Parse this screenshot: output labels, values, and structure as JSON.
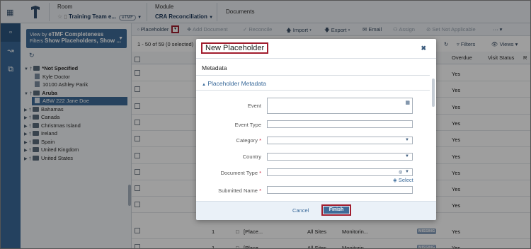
{
  "topbar": {
    "room_label": "Room",
    "room_value": "Training Team e...",
    "room_badge": "eTMF",
    "module_label": "Module",
    "module_value": "CRA Reconciliation",
    "documents_label": "Documents"
  },
  "tree": {
    "viewby_prefix": "View by",
    "viewby_value": "eTMF Completeness",
    "filters_prefix": "Filters",
    "filters_value": "Show Placeholders, Show ...",
    "nodes": [
      {
        "label": "*Not Specified",
        "type": "folder",
        "level": 0,
        "expanded": true
      },
      {
        "label": "Kyle Doctor",
        "type": "doc",
        "level": 1
      },
      {
        "label": "10100 Ashley Parik",
        "type": "doc",
        "level": 1
      },
      {
        "label": "Aruba",
        "type": "folder",
        "level": 0,
        "expanded": true
      },
      {
        "label": "ABW 222 Jane Doe",
        "type": "doc",
        "level": 1,
        "selected": true
      },
      {
        "label": "Bahamas",
        "type": "folder",
        "level": 0
      },
      {
        "label": "Canada",
        "type": "folder",
        "level": 0
      },
      {
        "label": "Christmas Island",
        "type": "folder",
        "level": 0
      },
      {
        "label": "Ireland",
        "type": "folder",
        "level": 0
      },
      {
        "label": "Spain",
        "type": "folder",
        "level": 0
      },
      {
        "label": "United Kingdom",
        "type": "folder",
        "level": 0
      },
      {
        "label": "United States",
        "type": "folder",
        "level": 0
      }
    ]
  },
  "toolbar": {
    "placeholder": "Placeholder",
    "add_document": "Add Document",
    "reconcile": "Reconcile",
    "import": "Import",
    "export": "Export",
    "email": "Email",
    "assign": "Assign",
    "set_not_applicable": "Set Not Applicable",
    "more": "···",
    "filters": "Filters",
    "views": "Views"
  },
  "grid": {
    "count_text": "1 - 50 of 59 (0 selected)",
    "columns": {
      "overdue": "Overdue",
      "visit_status": "Visit Status",
      "r": "R"
    },
    "rows": [
      {
        "overdue": "Yes"
      },
      {
        "overdue": "Yes"
      },
      {
        "overdue": "Yes"
      },
      {
        "overdue": "Yes"
      },
      {
        "overdue": "Yes"
      },
      {
        "overdue": "Yes"
      },
      {
        "overdue": "Yes"
      },
      {
        "overdue": "Yes"
      },
      {
        "overdue": "Yes"
      }
    ],
    "bottom_rows": [
      {
        "num": "1",
        "name": "[Place...",
        "site": "All Sites",
        "type": "Monitorin...",
        "status": "MISSING",
        "overdue": "Yes"
      },
      {
        "num": "1",
        "name": "[Place...",
        "site": "All Sites",
        "type": "Monitorin...",
        "status": "MISSING",
        "overdue": "Yes"
      }
    ]
  },
  "modal": {
    "title": "New Placeholder",
    "section": "Metadata",
    "subsection": "Placeholder Metadata",
    "fields": {
      "event": {
        "label": "Event",
        "value": ""
      },
      "event_type": {
        "label": "Event Type",
        "value": ""
      },
      "category": {
        "label": "Category",
        "value": "",
        "required": true
      },
      "country": {
        "label": "Country",
        "value": ""
      },
      "document_type": {
        "label": "Document Type",
        "value": "",
        "required": true
      },
      "submitted_name": {
        "label": "Submitted Name",
        "value": "",
        "required": true
      }
    },
    "select_link": "Select",
    "cancel": "Cancel",
    "finish": "Finish"
  }
}
